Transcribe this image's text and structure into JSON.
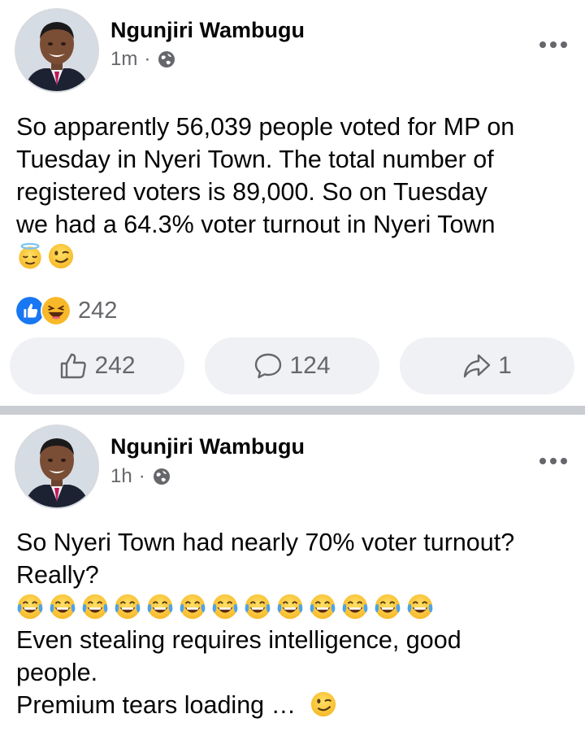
{
  "posts": [
    {
      "author": "Ngunjiri Wambugu",
      "time": "1m",
      "time_sep": "·",
      "lines": [
        "So apparently 56,039 people voted for MP on",
        "Tuesday in Nyeri Town. The total number of",
        "registered voters is 89,000. So on Tuesday",
        "we had a 64.3% voter turnout in Nyeri Town"
      ],
      "emojis": [
        "relieved-face-with-halo",
        "winking-face"
      ],
      "reactions": {
        "icons": [
          "like-reaction-icon",
          "haha-reaction-icon"
        ],
        "count": "242"
      },
      "actions": {
        "like": "242",
        "comment": "124",
        "share": "1"
      }
    },
    {
      "author": "Ngunjiri Wambugu",
      "time": "1h",
      "time_sep": "·",
      "lines": [
        "So Nyeri Town had nearly 70% voter turnout?",
        "Really?",
        "Even stealing requires intelligence, good",
        "people.",
        "Premium tears loading …"
      ],
      "crying_laughing_count": 13,
      "trailing_emoji": "winking-face"
    }
  ],
  "colors": {
    "like_blue": "#1877f2",
    "emoji_yellow": "#ffcc33",
    "muted": "#65676b",
    "button_bg": "#eff1f4"
  }
}
